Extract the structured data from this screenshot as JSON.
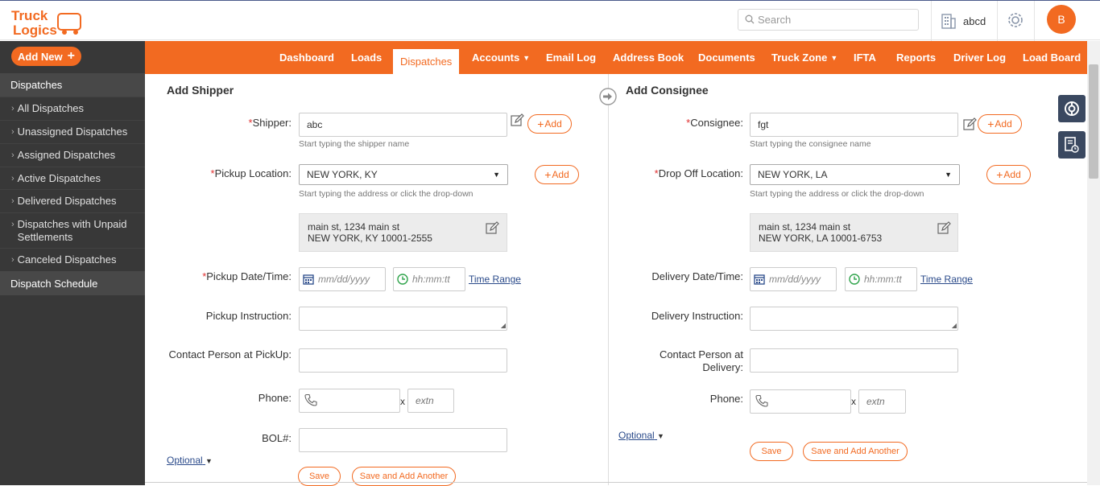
{
  "app": {
    "logo_line1": "Truck",
    "logo_line2": "Logics",
    "brand_color": "#f26a21"
  },
  "header": {
    "search_placeholder": "Search",
    "company": "abcd",
    "user_initial": "B"
  },
  "sidebar": {
    "add_new_label": "Add New",
    "section_title": "Dispatches",
    "items": [
      {
        "label": "All Dispatches"
      },
      {
        "label": "Unassigned Dispatches"
      },
      {
        "label": "Assigned Dispatches"
      },
      {
        "label": "Active Dispatches"
      },
      {
        "label": "Delivered Dispatches"
      },
      {
        "label": "Dispatches with Unpaid Settlements"
      },
      {
        "label": "Canceled Dispatches"
      }
    ],
    "schedule_label": "Dispatch Schedule"
  },
  "nav": {
    "items": [
      {
        "label": "Dashboard"
      },
      {
        "label": "Loads"
      },
      {
        "label": "Dispatches",
        "active": true
      },
      {
        "label": "Accounts",
        "has_dropdown": true
      },
      {
        "label": "Email Log"
      },
      {
        "label": "Address Book"
      },
      {
        "label": "Documents"
      },
      {
        "label": "Truck Zone",
        "has_dropdown": true
      },
      {
        "label": "IFTA"
      },
      {
        "label": "Reports"
      },
      {
        "label": "Driver Log"
      },
      {
        "label": "Load Board"
      }
    ]
  },
  "shipper": {
    "title": "Add Shipper",
    "shipper_label": "Shipper:",
    "shipper_value": "abc",
    "shipper_hint": "Start typing the shipper name",
    "add_label": "Add",
    "location_label": "Pickup Location:",
    "location_value": "NEW YORK, KY",
    "location_hint": "Start typing the address or click the drop-down",
    "address_line1": "main st, 1234 main st",
    "address_line2": "NEW YORK, KY 10001-2555",
    "date_label": "Pickup Date/Time:",
    "date_placeholder": "mm/dd/yyyy",
    "time_placeholder": "hh:mm:tt",
    "time_range_label": "Time Range",
    "instruction_label": "Pickup Instruction:",
    "contact_label": "Contact Person at PickUp:",
    "phone_label": "Phone:",
    "x_label": "x",
    "extn_placeholder": "extn",
    "bol_label": "BOL#:",
    "optional_label": "Optional",
    "save_label": "Save",
    "save_add_label": "Save and Add Another"
  },
  "consignee": {
    "title": "Add Consignee",
    "consignee_label": "Consignee:",
    "consignee_value": "fgt",
    "consignee_hint": "Start typing the consignee name",
    "add_label": "Add",
    "location_label": "Drop Off Location:",
    "location_value": "NEW YORK, LA",
    "location_hint": "Start typing the address or click the drop-down",
    "address_line1": "main st, 1234 main st",
    "address_line2": "NEW YORK, LA 10001-6753",
    "date_label": "Delivery Date/Time:",
    "date_placeholder": "mm/dd/yyyy",
    "time_placeholder": "hh:mm:tt",
    "time_range_label": "Time Range",
    "instruction_label": "Delivery Instruction:",
    "contact_label_line1": "Contact Person at",
    "contact_label_line2": "Delivery:",
    "phone_label": "Phone:",
    "x_label": "x",
    "extn_placeholder": "extn",
    "optional_label": "Optional",
    "save_label": "Save",
    "save_add_label": "Save and Add Another"
  }
}
